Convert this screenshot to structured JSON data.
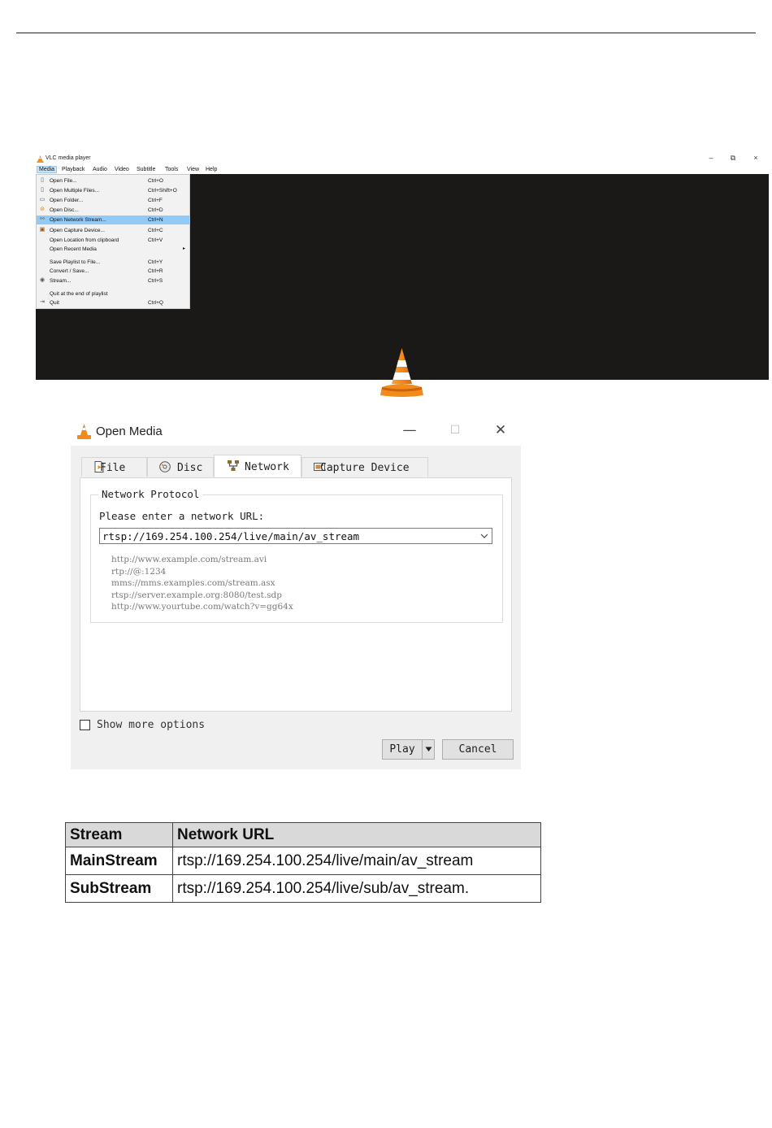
{
  "vlc_window": {
    "title": "VLC media player",
    "window_controls": {
      "minimize": "–",
      "restore": "⧉",
      "close": "×"
    },
    "menubar": [
      "Media",
      "Playback",
      "Audio",
      "Video",
      "Subtitle",
      "Tools",
      "View",
      "Help"
    ],
    "media_menu": [
      {
        "label": "Open File...",
        "shortcut": "Ctrl+O",
        "icon": "file-icon"
      },
      {
        "label": "Open Multiple Files...",
        "shortcut": "Ctrl+Shift+O",
        "icon": "files-icon"
      },
      {
        "label": "Open Folder...",
        "shortcut": "Ctrl+F",
        "icon": "folder-icon"
      },
      {
        "label": "Open Disc...",
        "shortcut": "Ctrl+D",
        "icon": "disc-icon"
      },
      {
        "label": "Open Network Stream...",
        "shortcut": "Ctrl+N",
        "icon": "network-icon",
        "highlighted": true
      },
      {
        "label": "Open Capture Device...",
        "shortcut": "Ctrl+C",
        "icon": "capture-icon"
      },
      {
        "label": "Open Location from clipboard",
        "shortcut": "Ctrl+V",
        "icon": ""
      },
      {
        "label": "Open Recent Media",
        "shortcut": "",
        "icon": "",
        "submenu": true
      },
      {
        "label": "Save Playlist to File...",
        "shortcut": "Ctrl+Y",
        "icon": ""
      },
      {
        "label": "Convert / Save...",
        "shortcut": "Ctrl+R",
        "icon": ""
      },
      {
        "label": "Stream...",
        "shortcut": "Ctrl+S",
        "icon": "stream-icon"
      },
      {
        "label": "Quit at the end of playlist",
        "shortcut": "",
        "icon": ""
      },
      {
        "label": "Quit",
        "shortcut": "Ctrl+Q",
        "icon": "quit-icon"
      }
    ]
  },
  "open_media": {
    "title": "Open Media",
    "window_controls": {
      "minimize": "—",
      "maximize": "☐",
      "close": "✕"
    },
    "tabs": [
      {
        "label": "File",
        "icon": "file-icon"
      },
      {
        "label": "Disc",
        "icon": "disc-icon"
      },
      {
        "label": "Network",
        "icon": "network-icon",
        "active": true
      },
      {
        "label": "Capture Device",
        "icon": "capture-icon"
      }
    ],
    "group_title": "Network Protocol",
    "url_prompt": "Please enter a network URL:",
    "url_value": "rtsp://169.254.100.254/live/main/av_stream",
    "examples": [
      "http://www.example.com/stream.avi",
      "rtp://@:1234",
      "mms://mms.examples.com/stream.asx",
      "rtsp://server.example.org:8080/test.sdp",
      "http://www.yourtube.com/watch?v=gg64x"
    ],
    "show_more_options": "Show more options",
    "show_more_checked": false,
    "play_label": "Play",
    "cancel_label": "Cancel"
  },
  "stream_table": {
    "headers": [
      "Stream",
      "Network URL"
    ],
    "rows": [
      [
        "MainStream",
        "rtsp://169.254.100.254/live/main/av_stream"
      ],
      [
        "SubStream",
        "rtsp://169.254.100.254/live/sub/av_stream."
      ]
    ]
  },
  "colors": {
    "vlc_orange": "#f28a1c",
    "video_bg": "#1a1917",
    "menu_highlight": "#91c9f7",
    "dialog_bg": "#f0f0f0",
    "table_header_bg": "#d9d9d9"
  }
}
